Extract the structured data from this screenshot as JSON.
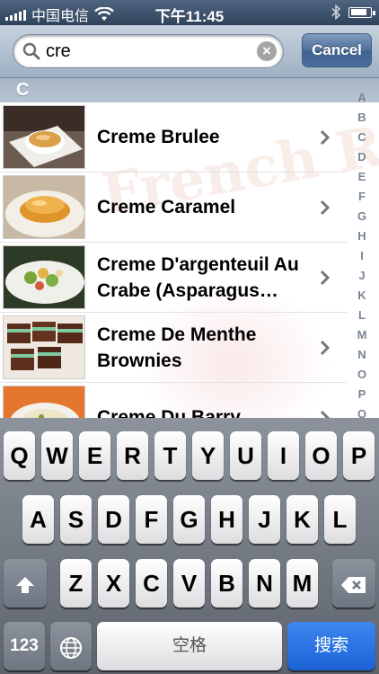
{
  "status_bar": {
    "carrier": "中国电信",
    "time": "下午11:45",
    "battery_level": 0.85
  },
  "search": {
    "query": "cre",
    "cancel_label": "Cancel"
  },
  "section_header": "C",
  "results": [
    {
      "title": "Creme Brulee"
    },
    {
      "title": "Creme Caramel"
    },
    {
      "title": "Creme D'argenteuil Au Crabe (Asparagus Soup)"
    },
    {
      "title": "Creme De Menthe Brownies"
    },
    {
      "title": "Creme Du Barry"
    }
  ],
  "watermark": "French Recipes",
  "index_letters": [
    "A",
    "B",
    "C",
    "D",
    "E",
    "F",
    "G",
    "H",
    "I",
    "J",
    "K",
    "L",
    "M",
    "N",
    "O",
    "P",
    "Q"
  ],
  "keyboard": {
    "row1": [
      "Q",
      "W",
      "E",
      "R",
      "T",
      "Y",
      "U",
      "I",
      "O",
      "P"
    ],
    "row2": [
      "A",
      "S",
      "D",
      "F",
      "G",
      "H",
      "J",
      "K",
      "L"
    ],
    "row3": [
      "Z",
      "X",
      "C",
      "V",
      "B",
      "N",
      "M"
    ],
    "numbers_label": "123",
    "space_label": "空格",
    "search_label": "搜索"
  },
  "colors": {
    "status_bar": "#3b4f69",
    "search_key": "#1f66dc",
    "cancel_button": "#4a6d9b"
  }
}
